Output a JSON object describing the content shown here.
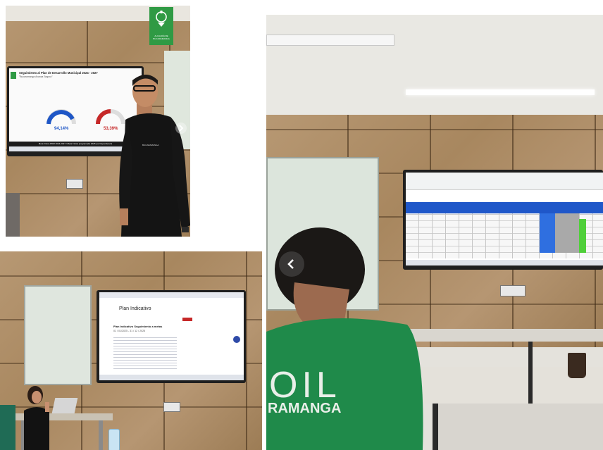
{
  "photos": {
    "top_left": {
      "logo_text": "ALCALDÍA DE BUCARAMANGA",
      "screen": {
        "title": "Seguimiento al Plan de Desarrollo Municipal 2024 - 2027",
        "subtitle": "\"Bucaramanga Avanza Segura\"",
        "gauge_left_value": "94,14%",
        "gauge_right_value": "53,39%",
        "footer_bar": "Meta Física PDM 2024-2027 / Meta Física programada 2025 por Dependencia"
      },
      "shirt_text": "BUCARAMANGA",
      "next_icon": "chevron-right-icon"
    },
    "bottom_left": {
      "screen": {
        "heading": "Plan Indicativo",
        "line1": "Plan Indicativo Seguimiento a metas",
        "line2": "01 / 01/2025 - 31 / 12 / 2025"
      }
    },
    "right": {
      "shirt_text_line1": "OIL",
      "shirt_text_line2": "RAMANGA",
      "prev_icon": "chevron-left-icon"
    }
  }
}
